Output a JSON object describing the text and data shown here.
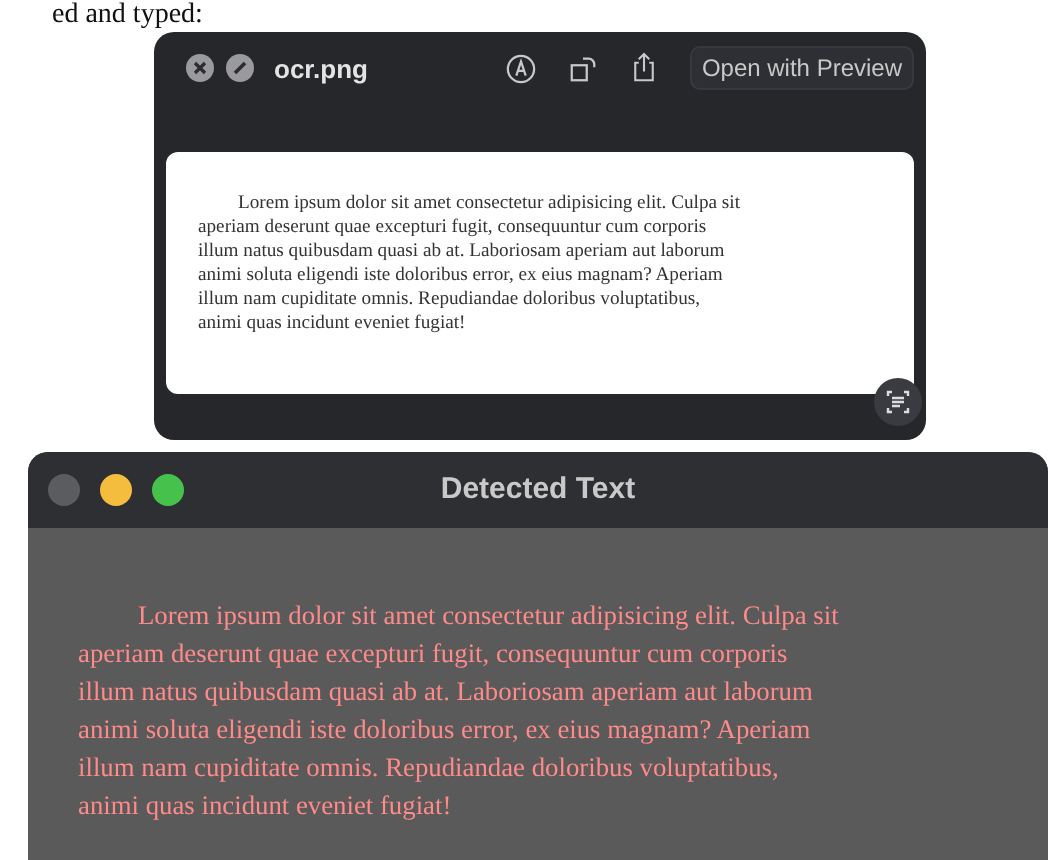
{
  "caption": "ed and typed:",
  "quicklook": {
    "title": "ocr.png",
    "button": "Open with Preview",
    "lines": [
      "Lorem ipsum dolor sit amet consectetur adipisicing elit. Culpa sit",
      "aperiam deserunt quae excepturi fugit, consequuntur cum corporis",
      "illum natus quibusdam quasi ab at. Laboriosam aperiam aut laborum",
      "animi soluta eligendi iste doloribus error, ex eius magnam? Aperiam",
      "illum nam cupiditate omnis. Repudiandae doloribus voluptatibus,",
      "animi quas incidunt eveniet fugiat!"
    ]
  },
  "detected": {
    "title": "Detected Text",
    "lines": [
      "Lorem ipsum dolor sit amet consectetur adipisicing elit. Culpa sit",
      "aperiam deserunt quae excepturi fugit, consequuntur cum corporis",
      "illum natus quibusdam quasi ab at. Laboriosam aperiam aut laborum",
      "animi soluta eligendi iste doloribus error, ex eius magnam? Aperiam",
      "illum nam cupiditate omnis. Repudiandae doloribus voluptatibus,",
      "animi quas incidunt eveniet fugiat!"
    ]
  }
}
